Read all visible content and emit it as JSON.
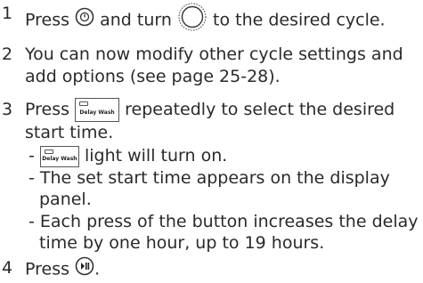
{
  "steps": [
    {
      "number": "1",
      "text_a": "Press",
      "text_b": "and turn",
      "text_c": "to the desired cycle."
    },
    {
      "number": "2",
      "line1": "You can now modify other cycle settings and",
      "line2": "add options (see page 25-28)."
    },
    {
      "number": "3",
      "text_a": "Press",
      "text_b": "repeatedly to select the desired",
      "line2": "start time.",
      "button_label": "Delay Wash",
      "bullets": [
        {
          "prefix": "-",
          "after_icon": "light will turn on."
        },
        {
          "line1": "- The set start time appears on the display",
          "line2": "panel."
        },
        {
          "line1": "- Each press of the button increases the delay",
          "line2": "time by one hour, up to 19 hours."
        }
      ]
    },
    {
      "number": "4",
      "text_a": "Press",
      "text_b": "."
    }
  ],
  "icons": {
    "power": "power-button-icon",
    "dial": "cycle-dial-icon",
    "start_pause": "start-pause-icon"
  }
}
